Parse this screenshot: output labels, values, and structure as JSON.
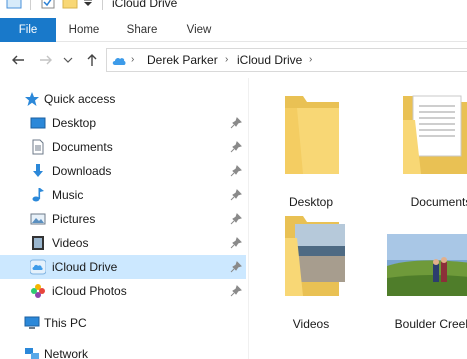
{
  "window": {
    "title": "iCloud Drive"
  },
  "ribbon": {
    "tabs": [
      {
        "label": "File"
      },
      {
        "label": "Home"
      },
      {
        "label": "Share"
      },
      {
        "label": "View"
      }
    ]
  },
  "address": {
    "path": [
      "Derek Parker",
      "iCloud Drive"
    ]
  },
  "nav": {
    "quick_access": "Quick access",
    "items": [
      {
        "label": "Desktop",
        "icon": "desktop-icon"
      },
      {
        "label": "Documents",
        "icon": "documents-icon"
      },
      {
        "label": "Downloads",
        "icon": "downloads-icon"
      },
      {
        "label": "Music",
        "icon": "music-icon"
      },
      {
        "label": "Pictures",
        "icon": "pictures-icon"
      },
      {
        "label": "Videos",
        "icon": "videos-icon"
      },
      {
        "label": "iCloud Drive",
        "icon": "icloud-drive-icon",
        "selected": true
      },
      {
        "label": "iCloud Photos",
        "icon": "icloud-photos-icon"
      }
    ],
    "this_pc": "This PC",
    "network": "Network"
  },
  "content": {
    "items": [
      {
        "name": "Desktop",
        "type": "folder"
      },
      {
        "name": "Documents",
        "type": "folder-documents"
      },
      {
        "name": "Videos",
        "type": "folder-videos"
      },
      {
        "name": "Boulder Creek",
        "type": "photo"
      }
    ]
  },
  "colors": {
    "accent": "#1979ca",
    "selection": "#cce8ff",
    "folder": "#f8d775"
  }
}
